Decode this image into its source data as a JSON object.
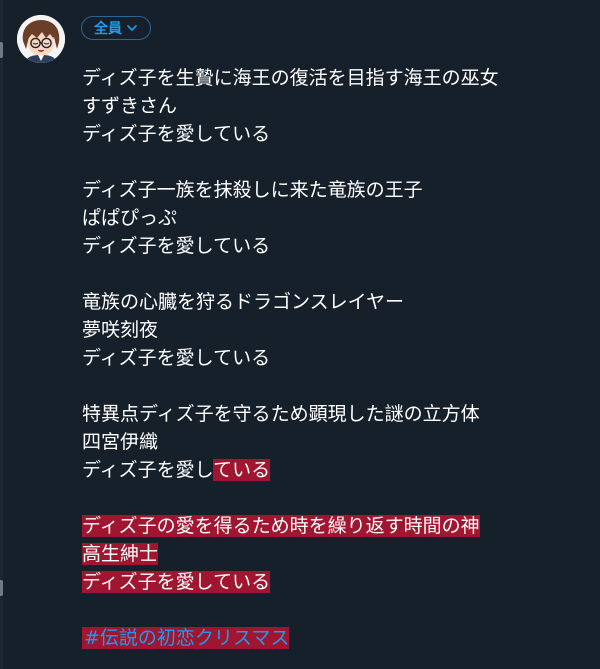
{
  "composer": {
    "audience_label": "全員",
    "audience_icon": "chevron-down-icon",
    "accent_color": "#1d9bf0",
    "highlight_color": "#a01530",
    "background_color": "#15202b"
  },
  "tweet": {
    "lines": [
      "ディズ子を生贄に海王の復活を目指す海王の巫女",
      "すずきさん",
      "ディズ子を愛している",
      "",
      "ディズ子一族を抹殺しに来た竜族の王子",
      "ぱぱぴっぷ",
      "ディズ子を愛している",
      "",
      "竜族の心臓を狩るドラゴンスレイヤー",
      "夢咲刻夜",
      "ディズ子を愛している",
      "",
      "特異点ディズ子を守るため顕現した謎の立方体",
      "四宮伊織",
      "ディズ子を愛し",
      "ている",
      "",
      "ディズ子の愛を得るため時を繰り返す時間の神",
      "高生紳士",
      "ディズ子を愛している",
      "",
      "#伝説の初恋クリスマス"
    ]
  }
}
